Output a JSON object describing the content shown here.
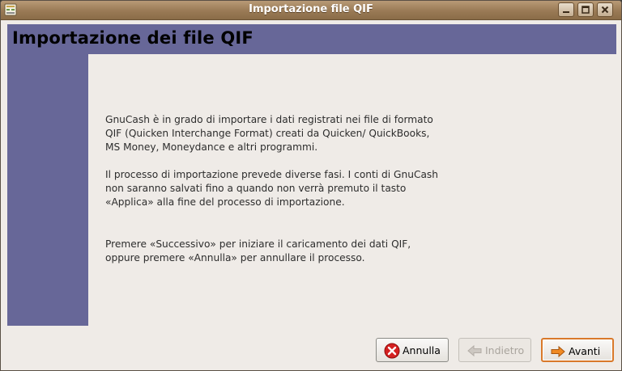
{
  "window": {
    "title": "Importazione file QIF"
  },
  "header": {
    "title": "Importazione dei file QIF"
  },
  "content": {
    "paragraphs": [
      "GnuCash è in grado di importare i dati registrati nei file di formato QIF (Quicken Interchange Format) creati da Quicken/ QuickBooks, MS Money, Moneydance e altri programmi.",
      "Il processo di importazione prevede diverse fasi. I conti di GnuCash non saranno salvati fino a quando non verrà premuto il tasto «Applica» alla fine del processo di importazione.",
      "Premere «Successivo» per iniziare il caricamento dei dati QIF, oppure premere «Annulla» per annullare il processo."
    ]
  },
  "buttons": {
    "cancel": "Annulla",
    "back": "Indietro",
    "forward": "Avanti"
  },
  "colors": {
    "accent_panel": "#676798",
    "titlebar": "#997a55",
    "default_button_border": "#d9792a"
  }
}
